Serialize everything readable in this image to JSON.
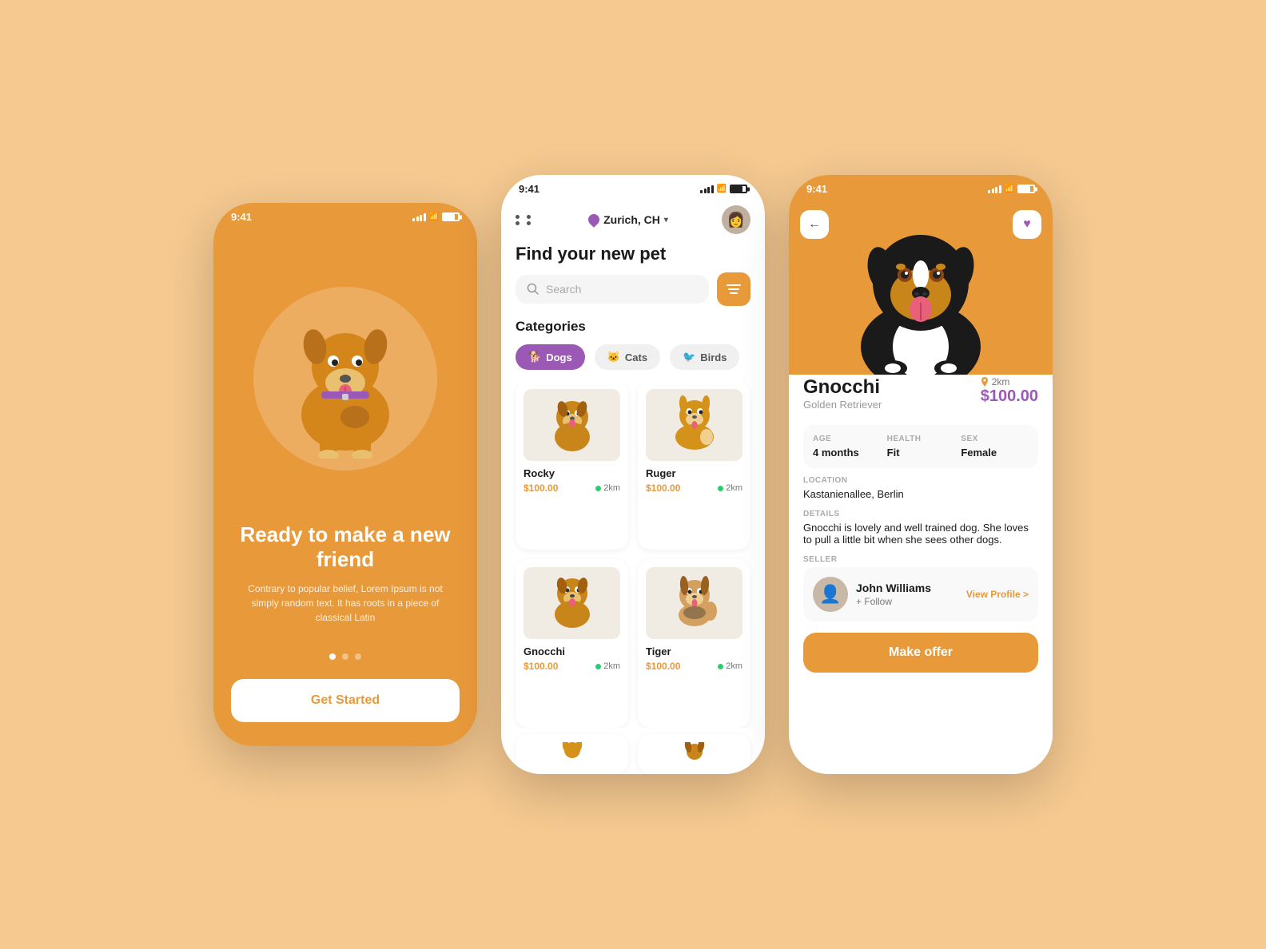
{
  "background": "#f5c990",
  "phone1": {
    "statusTime": "9:41",
    "title": "Ready to make a new friend",
    "subtitle": "Contrary to popular belief, Lorem Ipsum is not simply random text. It has roots in a piece of classical Latin",
    "dots": [
      "active",
      "inactive",
      "inactive"
    ],
    "cta": "Get Started"
  },
  "phone2": {
    "statusTime": "9:41",
    "location": "Zurich, CH",
    "title": "Find your new pet",
    "search": {
      "placeholder": "Search"
    },
    "categories": {
      "label": "Categories",
      "items": [
        {
          "name": "Dogs",
          "active": true
        },
        {
          "name": "Cats",
          "active": false
        },
        {
          "name": "Birds",
          "active": false
        }
      ]
    },
    "pets": [
      {
        "name": "Rocky",
        "price": "$100.00",
        "distance": "2km",
        "emoji": "🐕"
      },
      {
        "name": "Ruger",
        "price": "$100.00",
        "distance": "2km",
        "emoji": "🐕"
      },
      {
        "name": "Gnocchi",
        "price": "$100.00",
        "distance": "2km",
        "emoji": "🐕"
      },
      {
        "name": "Tiger",
        "price": "$100.00",
        "distance": "2km",
        "emoji": "🐕"
      }
    ],
    "morePets": [
      "🐕",
      "🐕"
    ]
  },
  "phone3": {
    "statusTime": "9:41",
    "petName": "Gnocchi",
    "petBreed": "Golden Retriever",
    "petDistance": "2km",
    "petPrice": "$100.00",
    "stats": {
      "age": {
        "label": "AGE",
        "value": "4 months"
      },
      "health": {
        "label": "HEALTH",
        "value": "Fit"
      },
      "sex": {
        "label": "SEX",
        "value": "Female"
      }
    },
    "locationLabel": "LOCATION",
    "locationValue": "Kastanienallee, Berlin",
    "detailsLabel": "DETAILS",
    "detailsValue": "Gnocchi is lovely and well trained dog. She loves to pull a little bit when she sees other dogs.",
    "sellerLabel": "SELLER",
    "sellerName": "John Williams",
    "sellerFollow": "+ Follow",
    "viewProfile": "View Profile >",
    "cta": "Make offer"
  }
}
